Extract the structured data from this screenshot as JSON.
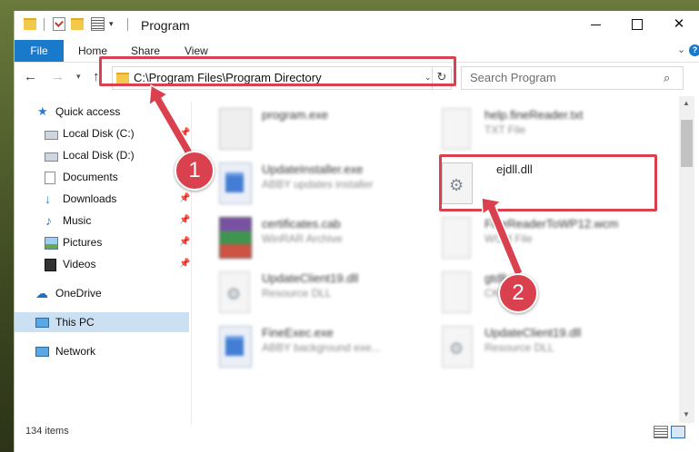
{
  "window": {
    "title": "Program",
    "minimize_glyph": "",
    "close_glyph": "✕"
  },
  "ribbon": {
    "file": "File",
    "home": "Home",
    "share": "Share",
    "view": "View",
    "expand_glyph": "⌄",
    "help_glyph": "?"
  },
  "nav": {
    "back_glyph": "←",
    "forward_glyph": "→",
    "recent_glyph": "▾",
    "up_glyph": "↑",
    "address": "C:\\Program Files\\Program Directory",
    "address_drop_glyph": "⌄",
    "refresh_glyph": "↻",
    "search_placeholder": "Search Program",
    "search_glyph": "⌕"
  },
  "sidebar": {
    "items": [
      {
        "label": "Quick access",
        "icon": "star-icon",
        "pinned": false
      },
      {
        "label": "Local Disk (C:)",
        "icon": "drive-icon",
        "pinned": true
      },
      {
        "label": "Local Disk (D:)",
        "icon": "drive-icon",
        "pinned": false
      },
      {
        "label": "Documents",
        "icon": "documents-icon",
        "pinned": true
      },
      {
        "label": "Downloads",
        "icon": "download-icon",
        "pinned": true
      },
      {
        "label": "Music",
        "icon": "music-icon",
        "pinned": true
      },
      {
        "label": "Pictures",
        "icon": "pictures-icon",
        "pinned": true
      },
      {
        "label": "Videos",
        "icon": "videos-icon",
        "pinned": true
      },
      {
        "label": "OneDrive",
        "icon": "cloud-icon",
        "pinned": false
      },
      {
        "label": "This PC",
        "icon": "computer-icon",
        "pinned": false,
        "selected": true
      },
      {
        "label": "Network",
        "icon": "network-icon",
        "pinned": false
      }
    ],
    "pin_glyph": "📌"
  },
  "files": [
    {
      "name": "program.exe",
      "type": "",
      "icon": "program-icon",
      "blurred": true
    },
    {
      "name": "help.fineReader.txt",
      "type": "TXT File",
      "icon": "document-icon",
      "blurred": true
    },
    {
      "name": "UpdateInstaller.exe",
      "type": "ABBY updates installer",
      "icon": "exe-icon",
      "blurred": true
    },
    {
      "name": "ejdll.dll",
      "type": "",
      "icon": "dll-gear-icon",
      "blurred": false
    },
    {
      "name": "certificates.cab",
      "type": "WinRAR Archive",
      "icon": "archive-icon",
      "blurred": true
    },
    {
      "name": "FineReaderToWP12.wcm",
      "type": "WCM File",
      "icon": "document-icon",
      "blurred": true
    },
    {
      "name": "UpdateClient19.dll",
      "type": "Resource DLL",
      "icon": "dll-gear-icon",
      "blurred": true
    },
    {
      "name": "gtdll.dll",
      "type": "CKF File",
      "icon": "document-icon",
      "blurred": true
    },
    {
      "name": "FineExec.exe",
      "type": "ABBY background exe...",
      "icon": "exe-icon",
      "blurred": true
    },
    {
      "name": "UpdateClient19.dll",
      "type": "Resource DLL",
      "icon": "dll-gear-icon",
      "blurred": true
    }
  ],
  "status": {
    "count": "134 items"
  },
  "callouts": {
    "one": "1",
    "two": "2"
  },
  "colors": {
    "accent": "#1979ca",
    "highlight_red": "#d9414e",
    "selection": "#cce0f4",
    "folder": "#f3c84b"
  }
}
